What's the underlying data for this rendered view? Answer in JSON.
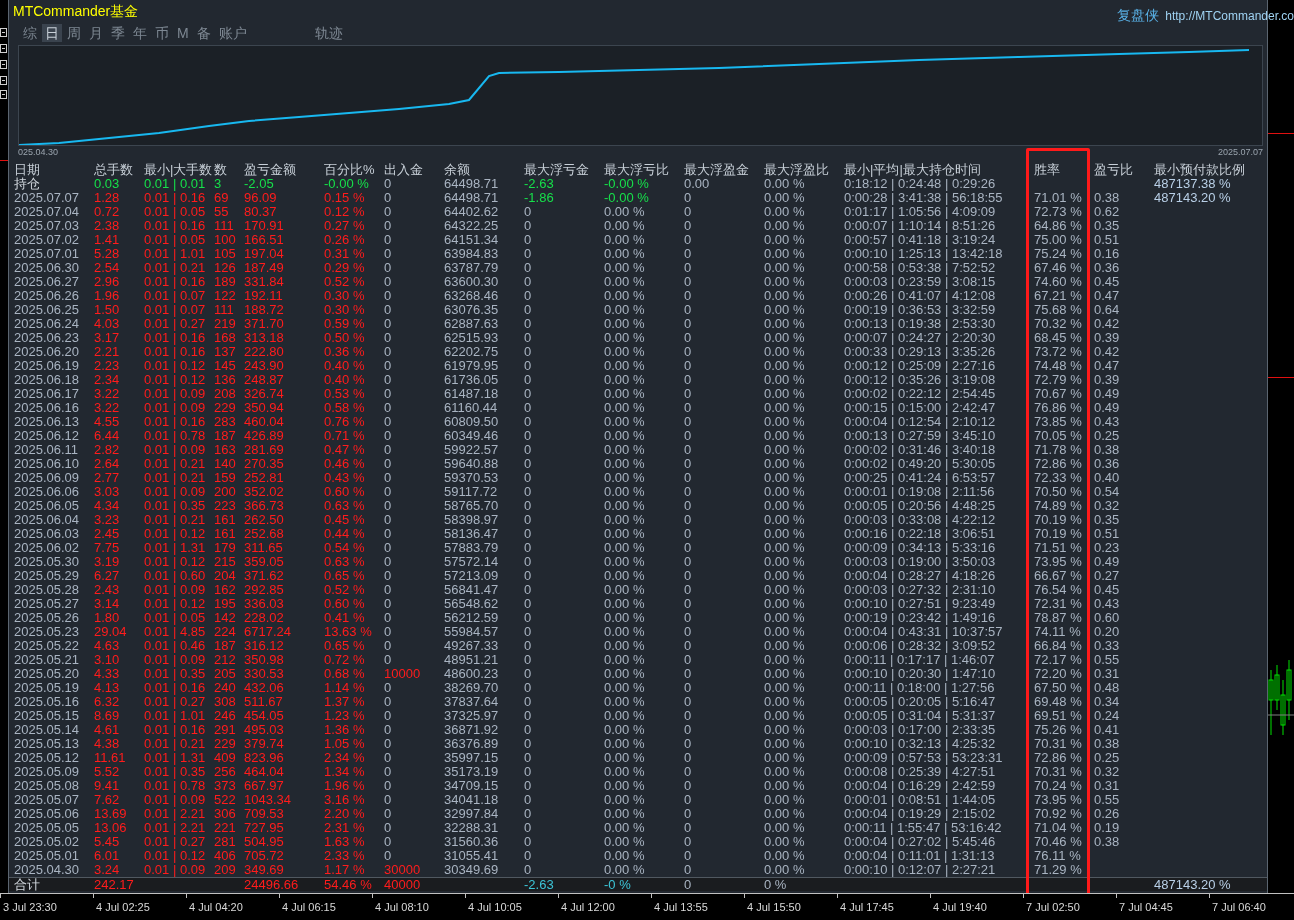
{
  "title": "MTCommander基金",
  "brand": "复盘侠",
  "url": "http://MTCommander.co",
  "tabs": [
    {
      "label": "综",
      "selected": false,
      "kind": "period"
    },
    {
      "label": "日",
      "selected": true,
      "kind": "period"
    },
    {
      "label": "周",
      "selected": false,
      "kind": "period"
    },
    {
      "label": "月",
      "selected": false,
      "kind": "period"
    },
    {
      "label": "季",
      "selected": false,
      "kind": "period"
    },
    {
      "label": "年",
      "selected": false,
      "kind": "period"
    },
    {
      "label": "币",
      "selected": false,
      "kind": "period"
    },
    {
      "label": "M",
      "selected": false,
      "kind": "period"
    },
    {
      "label": "备",
      "selected": false,
      "kind": "period"
    },
    {
      "label": "账户",
      "selected": false,
      "kind": "period"
    },
    {
      "label": "轨迹",
      "selected": false,
      "kind": "view"
    }
  ],
  "equity_chart": {
    "start_label": "025.04.30",
    "end_label": "2025.07.07"
  },
  "columns": [
    {
      "label": "日期",
      "highlighted": false
    },
    {
      "label": "总手数",
      "highlighted": false
    },
    {
      "label": "最小|大手数",
      "highlighted": false
    },
    {
      "label": "数",
      "highlighted": false
    },
    {
      "label": "盈亏金额",
      "highlighted": false
    },
    {
      "label": "百分比%",
      "highlighted": false
    },
    {
      "label": "出入金",
      "highlighted": false
    },
    {
      "label": "余额",
      "highlighted": false
    },
    {
      "label": "最大浮亏金",
      "highlighted": false
    },
    {
      "label": "最大浮亏比",
      "highlighted": false
    },
    {
      "label": "最大浮盈金",
      "highlighted": false
    },
    {
      "label": "最大浮盈比",
      "highlighted": false
    },
    {
      "label": "最小|平均|最大持仓时间",
      "highlighted": false
    },
    {
      "label": "胜率",
      "highlighted": true
    },
    {
      "label": "盈亏比",
      "highlighted": false
    },
    {
      "label": "最小预付款比例",
      "highlighted": false
    }
  ],
  "rows": [
    {
      "kind": "position",
      "profit": false,
      "deposit": false,
      "float_loss": true,
      "cells": [
        "持仓",
        "0.03",
        "0.01 | 0.01",
        "3",
        "-2.05",
        "-0.00 %",
        "0",
        "64498.71",
        "-2.63",
        "-0.00 %",
        "0.00",
        "0.00 %",
        "0:18:12 | 0:24:48 | 0:29:26",
        null,
        null,
        "487137.38 %"
      ]
    },
    {
      "kind": "day",
      "profit": true,
      "deposit": false,
      "float_loss": true,
      "cells": [
        "2025.07.07",
        "1.28",
        "0.01 | 0.16",
        "69",
        "96.09",
        "0.15 %",
        "0",
        "64498.71",
        "-1.86",
        "-0.00 %",
        "0",
        "0.00 %",
        "0:00:28 | 3:41:38 | 56:18:55",
        "71.01 %",
        "0.38",
        "487143.20 %"
      ]
    },
    {
      "kind": "day",
      "profit": true,
      "deposit": false,
      "float_loss": false,
      "cells": [
        "2025.07.04",
        "0.72",
        "0.01 | 0.05",
        "55",
        "80.37",
        "0.12 %",
        "0",
        "64402.62",
        "0",
        "0.00 %",
        "0",
        "0.00 %",
        "0:01:17 | 1:05:56 | 4:09:09",
        "72.73 %",
        "0.62",
        null
      ]
    },
    {
      "kind": "day",
      "profit": true,
      "deposit": false,
      "float_loss": false,
      "cells": [
        "2025.07.03",
        "2.38",
        "0.01 | 0.16",
        "111",
        "170.91",
        "0.27 %",
        "0",
        "64322.25",
        "0",
        "0.00 %",
        "0",
        "0.00 %",
        "0:00:07 | 1:10:14 | 8:51:26",
        "64.86 %",
        "0.35",
        null
      ]
    },
    {
      "kind": "day",
      "profit": true,
      "deposit": false,
      "float_loss": false,
      "cells": [
        "2025.07.02",
        "1.41",
        "0.01 | 0.05",
        "100",
        "166.51",
        "0.26 %",
        "0",
        "64151.34",
        "0",
        "0.00 %",
        "0",
        "0.00 %",
        "0:00:57 | 0:41:18 | 3:19:24",
        "75.00 %",
        "0.51",
        null
      ]
    },
    {
      "kind": "day",
      "profit": true,
      "deposit": false,
      "float_loss": false,
      "cells": [
        "2025.07.01",
        "5.28",
        "0.01 | 1.01",
        "105",
        "197.04",
        "0.31 %",
        "0",
        "63984.83",
        "0",
        "0.00 %",
        "0",
        "0.00 %",
        "0:00:10 | 1:25:13 | 13:42:18",
        "75.24 %",
        "0.16",
        null
      ]
    },
    {
      "kind": "day",
      "profit": true,
      "deposit": false,
      "float_loss": false,
      "cells": [
        "2025.06.30",
        "2.54",
        "0.01 | 0.21",
        "126",
        "187.49",
        "0.29 %",
        "0",
        "63787.79",
        "0",
        "0.00 %",
        "0",
        "0.00 %",
        "0:00:58 | 0:53:38 | 7:52:52",
        "67.46 %",
        "0.36",
        null
      ]
    },
    {
      "kind": "day",
      "profit": true,
      "deposit": false,
      "float_loss": false,
      "cells": [
        "2025.06.27",
        "2.96",
        "0.01 | 0.16",
        "189",
        "331.84",
        "0.52 %",
        "0",
        "63600.30",
        "0",
        "0.00 %",
        "0",
        "0.00 %",
        "0:00:03 | 0:23:59 | 3:08:15",
        "74.60 %",
        "0.45",
        null
      ]
    },
    {
      "kind": "day",
      "profit": true,
      "deposit": false,
      "float_loss": false,
      "cells": [
        "2025.06.26",
        "1.96",
        "0.01 | 0.07",
        "122",
        "192.11",
        "0.30 %",
        "0",
        "63268.46",
        "0",
        "0.00 %",
        "0",
        "0.00 %",
        "0:00:26 | 0:41:07 | 4:12:08",
        "67.21 %",
        "0.47",
        null
      ]
    },
    {
      "kind": "day",
      "profit": true,
      "deposit": false,
      "float_loss": false,
      "cells": [
        "2025.06.25",
        "1.50",
        "0.01 | 0.07",
        "111",
        "188.72",
        "0.30 %",
        "0",
        "63076.35",
        "0",
        "0.00 %",
        "0",
        "0.00 %",
        "0:00:19 | 0:36:53 | 3:32:59",
        "75.68 %",
        "0.64",
        null
      ]
    },
    {
      "kind": "day",
      "profit": true,
      "deposit": false,
      "float_loss": false,
      "cells": [
        "2025.06.24",
        "4.03",
        "0.01 | 0.27",
        "219",
        "371.70",
        "0.59 %",
        "0",
        "62887.63",
        "0",
        "0.00 %",
        "0",
        "0.00 %",
        "0:00:13 | 0:19:38 | 2:53:30",
        "70.32 %",
        "0.42",
        null
      ]
    },
    {
      "kind": "day",
      "profit": true,
      "deposit": false,
      "float_loss": false,
      "cells": [
        "2025.06.23",
        "3.17",
        "0.01 | 0.16",
        "168",
        "313.18",
        "0.50 %",
        "0",
        "62515.93",
        "0",
        "0.00 %",
        "0",
        "0.00 %",
        "0:00:07 | 0:24:27 | 2:20:30",
        "68.45 %",
        "0.39",
        null
      ]
    },
    {
      "kind": "day",
      "profit": true,
      "deposit": false,
      "float_loss": false,
      "cells": [
        "2025.06.20",
        "2.21",
        "0.01 | 0.16",
        "137",
        "222.80",
        "0.36 %",
        "0",
        "62202.75",
        "0",
        "0.00 %",
        "0",
        "0.00 %",
        "0:00:33 | 0:29:13 | 3:35:26",
        "73.72 %",
        "0.42",
        null
      ]
    },
    {
      "kind": "day",
      "profit": true,
      "deposit": false,
      "float_loss": false,
      "cells": [
        "2025.06.19",
        "2.23",
        "0.01 | 0.12",
        "145",
        "243.90",
        "0.40 %",
        "0",
        "61979.95",
        "0",
        "0.00 %",
        "0",
        "0.00 %",
        "0:00:12 | 0:25:09 | 2:27:16",
        "74.48 %",
        "0.47",
        null
      ]
    },
    {
      "kind": "day",
      "profit": true,
      "deposit": false,
      "float_loss": false,
      "cells": [
        "2025.06.18",
        "2.34",
        "0.01 | 0.12",
        "136",
        "248.87",
        "0.40 %",
        "0",
        "61736.05",
        "0",
        "0.00 %",
        "0",
        "0.00 %",
        "0:00:12 | 0:35:26 | 3:19:08",
        "72.79 %",
        "0.39",
        null
      ]
    },
    {
      "kind": "day",
      "profit": true,
      "deposit": false,
      "float_loss": false,
      "cells": [
        "2025.06.17",
        "3.22",
        "0.01 | 0.09",
        "208",
        "326.74",
        "0.53 %",
        "0",
        "61487.18",
        "0",
        "0.00 %",
        "0",
        "0.00 %",
        "0:00:02 | 0:22:12 | 2:54:45",
        "70.67 %",
        "0.49",
        null
      ]
    },
    {
      "kind": "day",
      "profit": true,
      "deposit": false,
      "float_loss": false,
      "cells": [
        "2025.06.16",
        "3.22",
        "0.01 | 0.09",
        "229",
        "350.94",
        "0.58 %",
        "0",
        "61160.44",
        "0",
        "0.00 %",
        "0",
        "0.00 %",
        "0:00:15 | 0:15:00 | 2:42:47",
        "76.86 %",
        "0.49",
        null
      ]
    },
    {
      "kind": "day",
      "profit": true,
      "deposit": false,
      "float_loss": false,
      "cells": [
        "2025.06.13",
        "4.55",
        "0.01 | 0.16",
        "283",
        "460.04",
        "0.76 %",
        "0",
        "60809.50",
        "0",
        "0.00 %",
        "0",
        "0.00 %",
        "0:00:04 | 0:12:54 | 2:10:12",
        "73.85 %",
        "0.43",
        null
      ]
    },
    {
      "kind": "day",
      "profit": true,
      "deposit": false,
      "float_loss": false,
      "cells": [
        "2025.06.12",
        "6.44",
        "0.01 | 0.78",
        "187",
        "426.89",
        "0.71 %",
        "0",
        "60349.46",
        "0",
        "0.00 %",
        "0",
        "0.00 %",
        "0:00:13 | 0:27:59 | 3:45:10",
        "70.05 %",
        "0.25",
        null
      ]
    },
    {
      "kind": "day",
      "profit": true,
      "deposit": false,
      "float_loss": false,
      "cells": [
        "2025.06.11",
        "2.82",
        "0.01 | 0.09",
        "163",
        "281.69",
        "0.47 %",
        "0",
        "59922.57",
        "0",
        "0.00 %",
        "0",
        "0.00 %",
        "0:00:02 | 0:31:46 | 3:40:18",
        "71.78 %",
        "0.38",
        null
      ]
    },
    {
      "kind": "day",
      "profit": true,
      "deposit": false,
      "float_loss": false,
      "cells": [
        "2025.06.10",
        "2.64",
        "0.01 | 0.21",
        "140",
        "270.35",
        "0.46 %",
        "0",
        "59640.88",
        "0",
        "0.00 %",
        "0",
        "0.00 %",
        "0:00:02 | 0:49:20 | 5:30:05",
        "72.86 %",
        "0.36",
        null
      ]
    },
    {
      "kind": "day",
      "profit": true,
      "deposit": false,
      "float_loss": false,
      "cells": [
        "2025.06.09",
        "2.77",
        "0.01 | 0.21",
        "159",
        "252.81",
        "0.43 %",
        "0",
        "59370.53",
        "0",
        "0.00 %",
        "0",
        "0.00 %",
        "0:00:25 | 0:41:24 | 6:53:57",
        "72.33 %",
        "0.40",
        null
      ]
    },
    {
      "kind": "day",
      "profit": true,
      "deposit": false,
      "float_loss": false,
      "cells": [
        "2025.06.06",
        "3.03",
        "0.01 | 0.09",
        "200",
        "352.02",
        "0.60 %",
        "0",
        "59117.72",
        "0",
        "0.00 %",
        "0",
        "0.00 %",
        "0:00:01 | 0:19:08 | 2:11:56",
        "70.50 %",
        "0.54",
        null
      ]
    },
    {
      "kind": "day",
      "profit": true,
      "deposit": false,
      "float_loss": false,
      "cells": [
        "2025.06.05",
        "4.34",
        "0.01 | 0.35",
        "223",
        "366.73",
        "0.63 %",
        "0",
        "58765.70",
        "0",
        "0.00 %",
        "0",
        "0.00 %",
        "0:00:05 | 0:20:56 | 4:48:25",
        "74.89 %",
        "0.32",
        null
      ]
    },
    {
      "kind": "day",
      "profit": true,
      "deposit": false,
      "float_loss": false,
      "cells": [
        "2025.06.04",
        "3.23",
        "0.01 | 0.21",
        "161",
        "262.50",
        "0.45 %",
        "0",
        "58398.97",
        "0",
        "0.00 %",
        "0",
        "0.00 %",
        "0:00:03 | 0:33:08 | 4:22:12",
        "70.19 %",
        "0.35",
        null
      ]
    },
    {
      "kind": "day",
      "profit": true,
      "deposit": false,
      "float_loss": false,
      "cells": [
        "2025.06.03",
        "2.45",
        "0.01 | 0.12",
        "161",
        "252.68",
        "0.44 %",
        "0",
        "58136.47",
        "0",
        "0.00 %",
        "0",
        "0.00 %",
        "0:00:16 | 0:22:18 | 3:06:51",
        "70.19 %",
        "0.51",
        null
      ]
    },
    {
      "kind": "day",
      "profit": true,
      "deposit": false,
      "float_loss": false,
      "cells": [
        "2025.06.02",
        "7.75",
        "0.01 | 1.31",
        "179",
        "311.65",
        "0.54 %",
        "0",
        "57883.79",
        "0",
        "0.00 %",
        "0",
        "0.00 %",
        "0:00:09 | 0:34:13 | 5:33:16",
        "71.51 %",
        "0.23",
        null
      ]
    },
    {
      "kind": "day",
      "profit": true,
      "deposit": false,
      "float_loss": false,
      "cells": [
        "2025.05.30",
        "3.19",
        "0.01 | 0.12",
        "215",
        "359.05",
        "0.63 %",
        "0",
        "57572.14",
        "0",
        "0.00 %",
        "0",
        "0.00 %",
        "0:00:03 | 0:19:00 | 3:50:03",
        "73.95 %",
        "0.49",
        null
      ]
    },
    {
      "kind": "day",
      "profit": true,
      "deposit": false,
      "float_loss": false,
      "cells": [
        "2025.05.29",
        "6.27",
        "0.01 | 0.60",
        "204",
        "371.62",
        "0.65 %",
        "0",
        "57213.09",
        "0",
        "0.00 %",
        "0",
        "0.00 %",
        "0:00:04 | 0:28:27 | 4:18:26",
        "66.67 %",
        "0.27",
        null
      ]
    },
    {
      "kind": "day",
      "profit": true,
      "deposit": false,
      "float_loss": false,
      "cells": [
        "2025.05.28",
        "2.43",
        "0.01 | 0.09",
        "162",
        "292.85",
        "0.52 %",
        "0",
        "56841.47",
        "0",
        "0.00 %",
        "0",
        "0.00 %",
        "0:00:03 | 0:27:32 | 2:31:10",
        "76.54 %",
        "0.45",
        null
      ]
    },
    {
      "kind": "day",
      "profit": true,
      "deposit": false,
      "float_loss": false,
      "cells": [
        "2025.05.27",
        "3.14",
        "0.01 | 0.12",
        "195",
        "336.03",
        "0.60 %",
        "0",
        "56548.62",
        "0",
        "0.00 %",
        "0",
        "0.00 %",
        "0:00:10 | 0:27:51 | 9:23:49",
        "72.31 %",
        "0.43",
        null
      ]
    },
    {
      "kind": "day",
      "profit": true,
      "deposit": false,
      "float_loss": false,
      "cells": [
        "2025.05.26",
        "1.80",
        "0.01 | 0.05",
        "142",
        "228.02",
        "0.41 %",
        "0",
        "56212.59",
        "0",
        "0.00 %",
        "0",
        "0.00 %",
        "0:00:19 | 0:23:42 | 1:49:16",
        "78.87 %",
        "0.60",
        null
      ]
    },
    {
      "kind": "day",
      "profit": true,
      "deposit": false,
      "float_loss": false,
      "cells": [
        "2025.05.23",
        "29.04",
        "0.01 | 4.85",
        "224",
        "6717.24",
        "13.63 %",
        "0",
        "55984.57",
        "0",
        "0.00 %",
        "0",
        "0.00 %",
        "0:00:04 | 0:43:31 | 10:37:57",
        "74.11 %",
        "0.20",
        null
      ]
    },
    {
      "kind": "day",
      "profit": true,
      "deposit": false,
      "float_loss": false,
      "cells": [
        "2025.05.22",
        "4.63",
        "0.01 | 0.46",
        "187",
        "316.12",
        "0.65 %",
        "0",
        "49267.33",
        "0",
        "0.00 %",
        "0",
        "0.00 %",
        "0:00:06 | 0:28:32 | 3:09:52",
        "66.84 %",
        "0.33",
        null
      ]
    },
    {
      "kind": "day",
      "profit": true,
      "deposit": false,
      "float_loss": false,
      "cells": [
        "2025.05.21",
        "3.10",
        "0.01 | 0.09",
        "212",
        "350.98",
        "0.72 %",
        "0",
        "48951.21",
        "0",
        "0.00 %",
        "0",
        "0.00 %",
        "0:00:11 | 0:17:17 | 1:46:07",
        "72.17 %",
        "0.55",
        null
      ]
    },
    {
      "kind": "day",
      "profit": true,
      "deposit": true,
      "float_loss": false,
      "cells": [
        "2025.05.20",
        "4.33",
        "0.01 | 0.35",
        "205",
        "330.53",
        "0.68 %",
        "10000",
        "48600.23",
        "0",
        "0.00 %",
        "0",
        "0.00 %",
        "0:00:10 | 0:20:30 | 1:47:10",
        "72.20 %",
        "0.31",
        null
      ]
    },
    {
      "kind": "day",
      "profit": true,
      "deposit": false,
      "float_loss": false,
      "cells": [
        "2025.05.19",
        "4.13",
        "0.01 | 0.16",
        "240",
        "432.06",
        "1.14 %",
        "0",
        "38269.70",
        "0",
        "0.00 %",
        "0",
        "0.00 %",
        "0:00:11 | 0:18:00 | 1:27:56",
        "67.50 %",
        "0.48",
        null
      ]
    },
    {
      "kind": "day",
      "profit": true,
      "deposit": false,
      "float_loss": false,
      "cells": [
        "2025.05.16",
        "6.32",
        "0.01 | 0.27",
        "308",
        "511.67",
        "1.37 %",
        "0",
        "37837.64",
        "0",
        "0.00 %",
        "0",
        "0.00 %",
        "0:00:05 | 0:20:05 | 5:16:47",
        "69.48 %",
        "0.34",
        null
      ]
    },
    {
      "kind": "day",
      "profit": true,
      "deposit": false,
      "float_loss": false,
      "cells": [
        "2025.05.15",
        "8.69",
        "0.01 | 1.01",
        "246",
        "454.05",
        "1.23 %",
        "0",
        "37325.97",
        "0",
        "0.00 %",
        "0",
        "0.00 %",
        "0:00:05 | 0:31:04 | 5:31:37",
        "69.51 %",
        "0.24",
        null
      ]
    },
    {
      "kind": "day",
      "profit": true,
      "deposit": false,
      "float_loss": false,
      "cells": [
        "2025.05.14",
        "4.61",
        "0.01 | 0.16",
        "291",
        "495.03",
        "1.36 %",
        "0",
        "36871.92",
        "0",
        "0.00 %",
        "0",
        "0.00 %",
        "0:00:03 | 0:17:00 | 2:33:35",
        "75.26 %",
        "0.41",
        null
      ]
    },
    {
      "kind": "day",
      "profit": true,
      "deposit": false,
      "float_loss": false,
      "cells": [
        "2025.05.13",
        "4.38",
        "0.01 | 0.21",
        "229",
        "379.74",
        "1.05 %",
        "0",
        "36376.89",
        "0",
        "0.00 %",
        "0",
        "0.00 %",
        "0:00:10 | 0:32:13 | 4:25:32",
        "70.31 %",
        "0.38",
        null
      ]
    },
    {
      "kind": "day",
      "profit": true,
      "deposit": false,
      "float_loss": false,
      "cells": [
        "2025.05.12",
        "11.61",
        "0.01 | 1.31",
        "409",
        "823.96",
        "2.34 %",
        "0",
        "35997.15",
        "0",
        "0.00 %",
        "0",
        "0.00 %",
        "0:00:09 | 0:57:53 | 53:23:31",
        "72.86 %",
        "0.25",
        null
      ]
    },
    {
      "kind": "day",
      "profit": true,
      "deposit": false,
      "float_loss": false,
      "cells": [
        "2025.05.09",
        "5.52",
        "0.01 | 0.35",
        "256",
        "464.04",
        "1.34 %",
        "0",
        "35173.19",
        "0",
        "0.00 %",
        "0",
        "0.00 %",
        "0:00:08 | 0:25:39 | 4:27:51",
        "70.31 %",
        "0.32",
        null
      ]
    },
    {
      "kind": "day",
      "profit": true,
      "deposit": false,
      "float_loss": false,
      "cells": [
        "2025.05.08",
        "9.41",
        "0.01 | 0.78",
        "373",
        "667.97",
        "1.96 %",
        "0",
        "34709.15",
        "0",
        "0.00 %",
        "0",
        "0.00 %",
        "0:00:04 | 0:16:29 | 2:42:59",
        "70.24 %",
        "0.31",
        null
      ]
    },
    {
      "kind": "day",
      "profit": true,
      "deposit": false,
      "float_loss": false,
      "cells": [
        "2025.05.07",
        "7.62",
        "0.01 | 0.09",
        "522",
        "1043.34",
        "3.16 %",
        "0",
        "34041.18",
        "0",
        "0.00 %",
        "0",
        "0.00 %",
        "0:00:01 | 0:08:51 | 1:44:05",
        "73.95 %",
        "0.55",
        null
      ]
    },
    {
      "kind": "day",
      "profit": true,
      "deposit": false,
      "float_loss": false,
      "cells": [
        "2025.05.06",
        "13.69",
        "0.01 | 2.21",
        "306",
        "709.53",
        "2.20 %",
        "0",
        "32997.84",
        "0",
        "0.00 %",
        "0",
        "0.00 %",
        "0:00:04 | 0:19:29 | 2:15:02",
        "70.92 %",
        "0.26",
        null
      ]
    },
    {
      "kind": "day",
      "profit": true,
      "deposit": false,
      "float_loss": false,
      "cells": [
        "2025.05.05",
        "13.06",
        "0.01 | 2.21",
        "221",
        "727.95",
        "2.31 %",
        "0",
        "32288.31",
        "0",
        "0.00 %",
        "0",
        "0.00 %",
        "0:00:11 | 1:55:47 | 53:16:42",
        "71.04 %",
        "0.19",
        null
      ]
    },
    {
      "kind": "day",
      "profit": true,
      "deposit": false,
      "float_loss": false,
      "cells": [
        "2025.05.02",
        "5.45",
        "0.01 | 0.27",
        "281",
        "504.95",
        "1.63 %",
        "0",
        "31560.36",
        "0",
        "0.00 %",
        "0",
        "0.00 %",
        "0:00:04 | 0:27:02 | 5:45:46",
        "70.46 %",
        "0.38",
        null
      ]
    },
    {
      "kind": "day",
      "profit": true,
      "deposit": false,
      "float_loss": false,
      "cells": [
        "2025.05.01",
        "6.01",
        "0.01 | 0.12",
        "406",
        "705.72",
        "2.33 %",
        "0",
        "31055.41",
        "0",
        "0.00 %",
        "0",
        "0.00 %",
        "0:00:04 | 0:11:01 | 1:31:13",
        "76.11 %",
        null,
        null
      ]
    },
    {
      "kind": "day",
      "profit": true,
      "deposit": true,
      "float_loss": false,
      "cells": [
        "2025.04.30",
        "3.24",
        "0.01 | 0.09",
        "209",
        "349.69",
        "1.17 %",
        "30000",
        "30349.69",
        "0",
        "0.00 %",
        "0",
        "0.00 %",
        "0:00:10 | 0:12:07 | 2:27:21",
        "71.29 %",
        null,
        null
      ]
    },
    {
      "kind": "total",
      "profit": true,
      "deposit": true,
      "float_loss": true,
      "cells": [
        "合计",
        "242.17",
        null,
        null,
        "24496.66",
        "54.46 %",
        "40000",
        null,
        "-2.63",
        "-0 %",
        "0",
        "0 %",
        null,
        null,
        null,
        "487143.20 %"
      ]
    }
  ],
  "time_axis": [
    "3 Jul 23:30",
    "4 Jul 02:25",
    "4 Jul 04:20",
    "4 Jul 06:15",
    "4 Jul 08:10",
    "4 Jul 10:05",
    "4 Jul 12:00",
    "4 Jul 13:55",
    "4 Jul 15:50",
    "4 Jul 17:45",
    "4 Jul 19:40",
    "7 Jul 02:50",
    "7 Jul 04:45",
    "7 Jul 06:40"
  ]
}
